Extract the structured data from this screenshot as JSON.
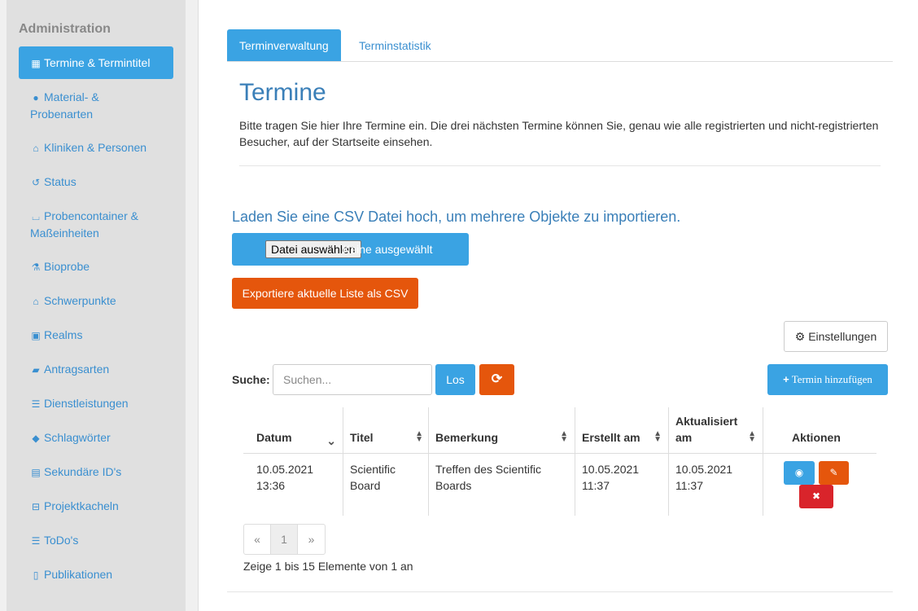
{
  "sidebar": {
    "title": "Administration",
    "items": [
      {
        "label": "Termine & Termintitel",
        "icon": "calendar-icon",
        "glyph": "▦"
      },
      {
        "label": "Material- & Probenarten",
        "line1": "Material- &",
        "line2": "Probenarten",
        "icon": "info-circle-icon",
        "glyph": "●"
      },
      {
        "label": "Kliniken & Personen",
        "icon": "home-icon",
        "glyph": "⌂"
      },
      {
        "label": "Status",
        "icon": "history-icon",
        "glyph": "↺"
      },
      {
        "label": "Probencontainer & Maßeinheiten",
        "line1": "Probencontainer &",
        "line2": "Maßeinheiten",
        "icon": "basket-icon",
        "glyph": "⌴"
      },
      {
        "label": "Bioprobe",
        "icon": "flask-icon",
        "glyph": "⚗"
      },
      {
        "label": "Schwerpunkte",
        "icon": "bank-icon",
        "glyph": "⌂"
      },
      {
        "label": "Realms",
        "icon": "microchip-icon",
        "glyph": "▣"
      },
      {
        "label": "Antragsarten",
        "icon": "book-icon",
        "glyph": "▰"
      },
      {
        "label": "Dienstleistungen",
        "icon": "list-icon",
        "glyph": "☰"
      },
      {
        "label": "Schlagwörter",
        "icon": "tags-icon",
        "glyph": "◆"
      },
      {
        "label": "Sekundäre ID's",
        "icon": "id-card-icon",
        "glyph": "▤"
      },
      {
        "label": "Projektkacheln",
        "icon": "minus-square-icon",
        "glyph": "⊟"
      },
      {
        "label": "ToDo's",
        "icon": "list-icon",
        "glyph": "☰"
      },
      {
        "label": "Publikationen",
        "icon": "file-text-icon",
        "glyph": "▯"
      }
    ]
  },
  "tabs": [
    {
      "label": "Terminverwaltung",
      "active": true
    },
    {
      "label": "Terminstatistik",
      "active": false
    }
  ],
  "page": {
    "title": "Termine",
    "intro": "Bitte tragen Sie hier Ihre Termine ein. Die drei nächsten Termine können Sie, genau wie alle registrierten und nicht-registrierten Besucher, auf der Startseite einsehen."
  },
  "csv": {
    "heading": "Laden Sie eine CSV Datei hoch, um mehrere Objekte zu importieren.",
    "file_button": "Datei auswählen",
    "file_status": "Keine ausgewählt",
    "export_label": "Exportiere aktuelle Liste als CSV"
  },
  "toolbar": {
    "settings_label": "Einstellungen",
    "search_label": "Suche:",
    "search_placeholder": "Suchen...",
    "go_label": "Los",
    "add_label": "Termin hinzufügen"
  },
  "table": {
    "columns": [
      "Datum",
      "Titel",
      "Bemerkung",
      "Erstellt am",
      "Aktualisiert am",
      "Aktionen"
    ],
    "col_aktualisiert_line1": "Aktualisiert",
    "col_aktualisiert_line2": "am",
    "rows": [
      {
        "datum": [
          "10.05.2021",
          "13:36"
        ],
        "titel": [
          "Scientific",
          "Board"
        ],
        "bemerkung": [
          "Treffen des Scientific",
          "Boards"
        ],
        "erstellt": [
          "10.05.2021",
          "11:37"
        ],
        "aktualisiert": [
          "10.05.2021",
          "11:37"
        ]
      }
    ]
  },
  "pagination": {
    "prev": "«",
    "current": "1",
    "next": "»"
  },
  "info": "Zeige 1 bis 15 Elemente von 1 an",
  "colors": {
    "primary": "#3aa3e3",
    "danger_orange": "#e5560c",
    "danger_red": "#d9242b",
    "sidebar_bg": "#e0e0e0",
    "link": "#3a8fd0"
  }
}
